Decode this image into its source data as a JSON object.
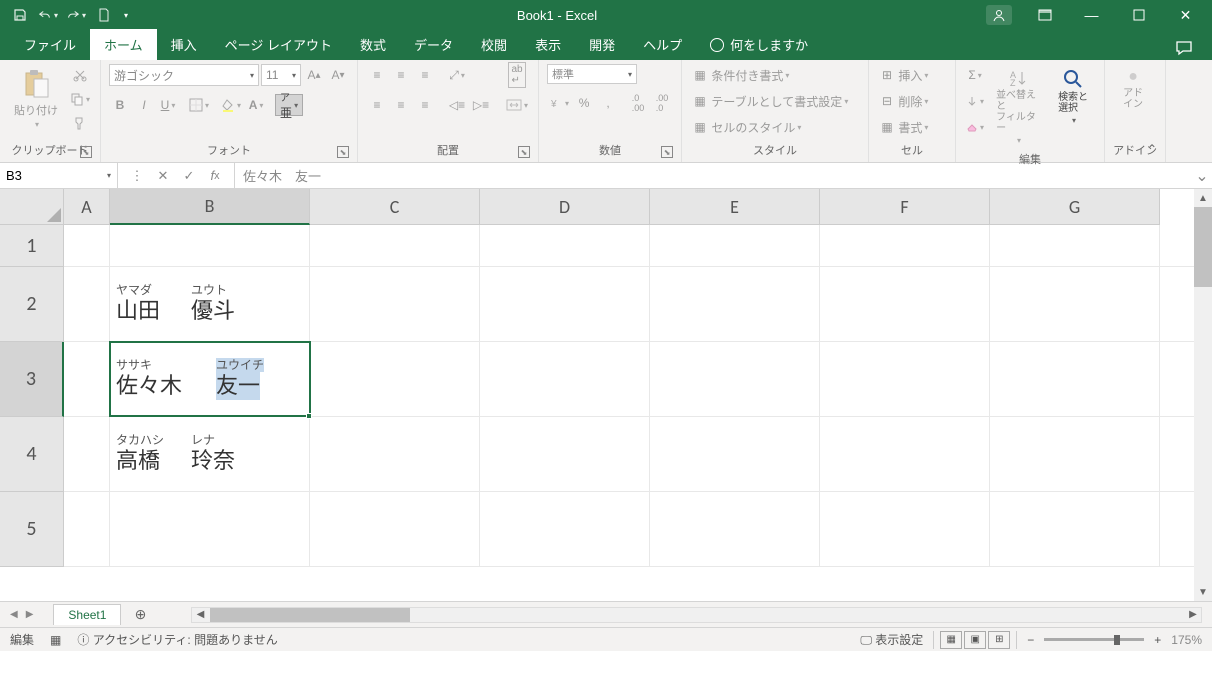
{
  "title": "Book1  -  Excel",
  "tabs": {
    "file": "ファイル",
    "home": "ホーム",
    "insert": "挿入",
    "pagelayout": "ページ レイアウト",
    "formulas": "数式",
    "data": "データ",
    "review": "校閲",
    "view": "表示",
    "developer": "開発",
    "help": "ヘルプ",
    "tellme": "何をしますか"
  },
  "ribbon": {
    "clipboard_label": "クリップボード",
    "paste": "貼り付け",
    "font_label": "フォント",
    "font_name": "游ゴシック",
    "font_size": "11",
    "alignment_label": "配置",
    "number_label": "数値",
    "number_format": "標準",
    "styles_label": "スタイル",
    "cond_format": "条件付き書式",
    "format_table": "テーブルとして書式設定",
    "cell_styles": "セルのスタイル",
    "cells_label": "セル",
    "insert_cell": "挿入",
    "delete_cell": "削除",
    "format_cell": "書式",
    "editing_label": "編集",
    "sort_filter": "並べ替えと\nフィルター",
    "find_select": "検索と\n選択",
    "addins_label": "アドイン",
    "addins": "アド\nイン"
  },
  "name_box": "B3",
  "formula_bar": "佐々木　友一",
  "columns": [
    "A",
    "B",
    "C",
    "D",
    "E",
    "F",
    "G"
  ],
  "rows": [
    "1",
    "2",
    "3",
    "4",
    "5"
  ],
  "cells": {
    "b2": {
      "ruby1": "ヤマダ",
      "ruby2": "ユウト",
      "text1": "山田",
      "text2": "優斗"
    },
    "b3": {
      "ruby1": "ササキ",
      "ruby2": "ユウイチ",
      "text1": "佐々木",
      "text2": "友一"
    },
    "b4": {
      "ruby1": "タカハシ",
      "ruby2": "レナ",
      "text1": "高橋",
      "text2": "玲奈"
    }
  },
  "sheet_tab": "Sheet1",
  "status": {
    "mode": "編集",
    "accessibility": "アクセシビリティ: 問題ありません",
    "display_settings": "表示設定",
    "zoom": "175%"
  }
}
